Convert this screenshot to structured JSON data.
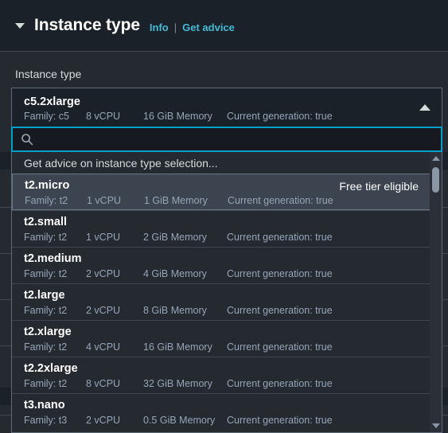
{
  "section": {
    "title": "Instance type",
    "info_label": "Info",
    "separator": "|",
    "advice_label": "Get advice",
    "collapse_icon": "caret-down-icon"
  },
  "field": {
    "label": "Instance type"
  },
  "selected": {
    "name": "c5.2xlarge",
    "family": "Family: c5",
    "vcpu": "8 vCPU",
    "memory": "16 GiB Memory",
    "generation": "Current generation: true",
    "caret_icon": "caret-up-icon"
  },
  "search": {
    "value": "",
    "placeholder": "",
    "icon": "search-icon"
  },
  "dropdown": {
    "advice_row": "Get advice on instance type selection...",
    "free_tier_badge": "Free tier eligible",
    "options": [
      {
        "name": "t2.micro",
        "family": "Family: t2",
        "vcpu": "1 vCPU",
        "memory": "1 GiB Memory",
        "generation": "Current generation: true",
        "free_tier": true,
        "highlighted": true
      },
      {
        "name": "t2.small",
        "family": "Family: t2",
        "vcpu": "1 vCPU",
        "memory": "2 GiB Memory",
        "generation": "Current generation: true",
        "free_tier": false,
        "highlighted": false
      },
      {
        "name": "t2.medium",
        "family": "Family: t2",
        "vcpu": "2 vCPU",
        "memory": "4 GiB Memory",
        "generation": "Current generation: true",
        "free_tier": false,
        "highlighted": false
      },
      {
        "name": "t2.large",
        "family": "Family: t2",
        "vcpu": "2 vCPU",
        "memory": "8 GiB Memory",
        "generation": "Current generation: true",
        "free_tier": false,
        "highlighted": false
      },
      {
        "name": "t2.xlarge",
        "family": "Family: t2",
        "vcpu": "4 vCPU",
        "memory": "16 GiB Memory",
        "generation": "Current generation: true",
        "free_tier": false,
        "highlighted": false
      },
      {
        "name": "t2.2xlarge",
        "family": "Family: t2",
        "vcpu": "8 vCPU",
        "memory": "32 GiB Memory",
        "generation": "Current generation: true",
        "free_tier": false,
        "highlighted": false
      },
      {
        "name": "t3.nano",
        "family": "Family: t3",
        "vcpu": "2 vCPU",
        "memory": "0.5 GiB Memory",
        "generation": "Current generation: true",
        "free_tier": false,
        "highlighted": false
      }
    ],
    "scrollbar": {
      "up_icon": "scroll-up-arrow-icon",
      "down_icon": "scroll-down-arrow-icon"
    }
  },
  "colors": {
    "page_bg": "#252a31",
    "header_bg": "#1b2128",
    "link": "#44b9d6",
    "focus_border": "#00a1c9",
    "highlight_row": "#3c444f",
    "meta_text": "#95a5b8"
  }
}
